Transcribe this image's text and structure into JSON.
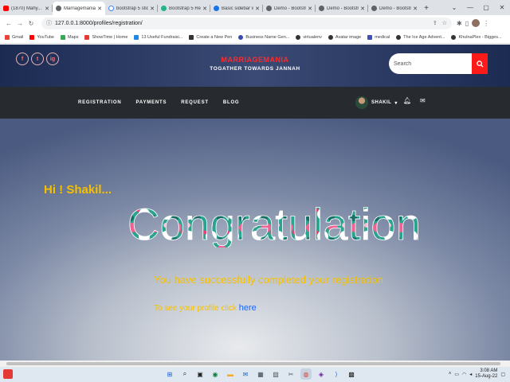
{
  "browser": {
    "tabs": [
      {
        "title": "(1870) Mahy...",
        "icon": "youtube-icon",
        "active": false
      },
      {
        "title": "Marriagemania| (",
        "icon": "globe-icon",
        "active": true
      },
      {
        "title": "bootstrap 5 stick",
        "icon": "google-icon",
        "active": false
      },
      {
        "title": "Bootstrap 5 Resp",
        "icon": "bootstrap-icon",
        "active": false
      },
      {
        "title": "Basic sidebar with",
        "icon": "blue-diamond-icon",
        "active": false
      },
      {
        "title": "Demo - Bootstrap",
        "icon": "globe-icon",
        "active": false
      },
      {
        "title": "Demo - Bootstrap",
        "icon": "globe-icon",
        "active": false
      },
      {
        "title": "Demo - Bootstrap",
        "icon": "globe-icon",
        "active": false
      }
    ],
    "url": "127.0.0.1:8000/profiles/registration/",
    "bookmarks": [
      {
        "label": "Gmail",
        "color": "#ea4335"
      },
      {
        "label": "YouTube",
        "color": "#ff0000"
      },
      {
        "label": "Maps",
        "color": "#34a853"
      },
      {
        "label": "ShowTime | Home",
        "color": "#e53935"
      },
      {
        "label": "13 Useful Fundraisi...",
        "color": "#1e88e5"
      },
      {
        "label": "Create a New Pen",
        "color": "#333333"
      },
      {
        "label": "Business Name Gen...",
        "color": "#3949ab"
      },
      {
        "label": "virtualenv",
        "color": "#333333"
      },
      {
        "label": "Avatar image",
        "color": "#333333"
      },
      {
        "label": "medical",
        "color": "#3f51b5"
      },
      {
        "label": "The Ice Age Advent...",
        "color": "#333333"
      },
      {
        "label": "KhulnaPlex - Bigges...",
        "color": "#333333"
      }
    ]
  },
  "site": {
    "brand": "MARRIAGEMANIA",
    "tagline": "TOGATHER TOWARDS JANNAH",
    "search_placeholder": "Search",
    "social": [
      "f",
      "t",
      "ig"
    ],
    "nav": [
      "REGISTRATION",
      "PAYMENTS",
      "REQUEST",
      "BLOG"
    ],
    "user": "SHAKIL",
    "greeting": "Hi ! Shakil...",
    "congrats": "Congratulation",
    "success_message": "You have successfully completed your registration",
    "profile_prompt": "To see your profile click ",
    "profile_link": "here"
  },
  "taskbar": {
    "time": "3:08 AM",
    "date": "15-Aug-22"
  },
  "colors": {
    "brand_red": "#ff2a2a",
    "accent_yellow": "#f6c000",
    "link_blue": "#1565ff",
    "nav_dark": "#272a2e"
  }
}
